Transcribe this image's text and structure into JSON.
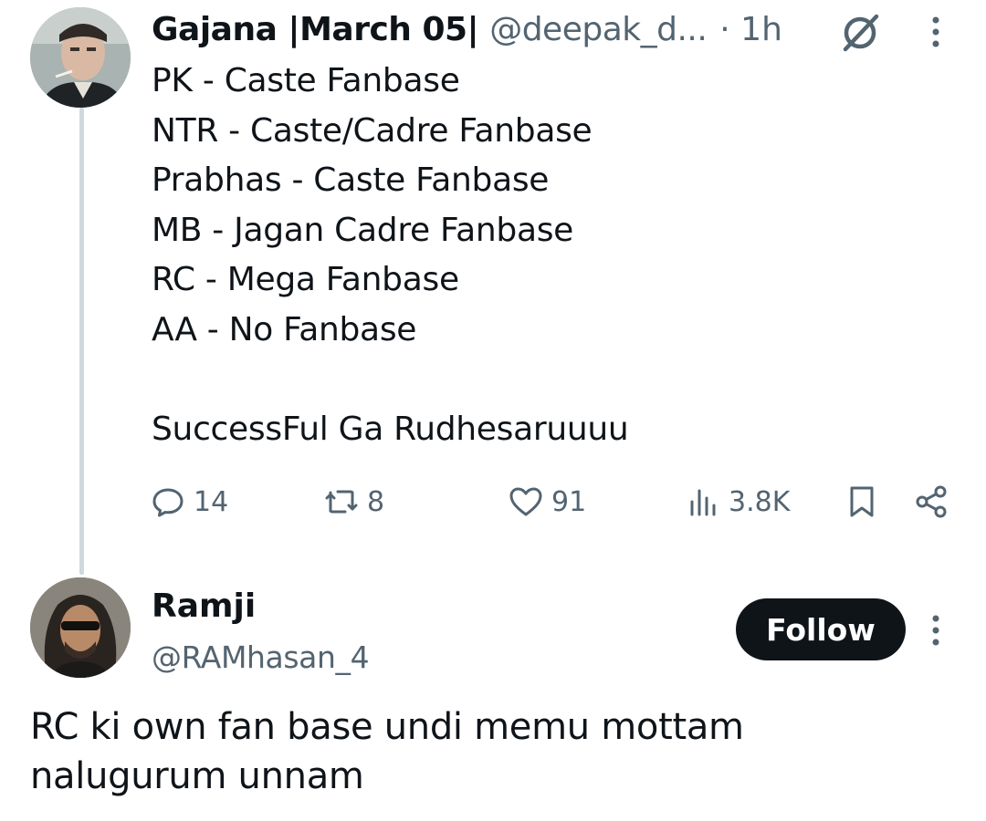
{
  "tweet1": {
    "display_name": "Gajana |March 05|",
    "handle": "@deepak_d...",
    "time": "· 1h",
    "lines": [
      "PK - Caste Fanbase",
      "NTR - Caste/Cadre Fanbase",
      "Prabhas - Caste Fanbase",
      "MB - Jagan Cadre Fanbase",
      "RC - Mega Fanbase",
      "AA - No Fanbase",
      "",
      "SuccessFul Ga Rudhesaruuuu"
    ],
    "actions": {
      "replies": "14",
      "retweets": "8",
      "likes": "91",
      "views": "3.8K"
    },
    "icons": {
      "grok": "grok-icon",
      "more": "more-vertical-icon",
      "reply": "reply-icon",
      "retweet": "retweet-icon",
      "like": "heart-icon",
      "views": "views-icon",
      "bookmark": "bookmark-icon",
      "share": "share-icon"
    }
  },
  "tweet2": {
    "display_name": "Ramji",
    "handle": "@RAMhasan_4",
    "follow_label": "Follow",
    "text_lines": [
      "RC ki own fan base undi memu mottam",
      "nalugurum unnam"
    ]
  },
  "colors": {
    "text_primary": "#0f1419",
    "text_secondary": "#536471",
    "thread_line": "#cfd9de",
    "follow_bg": "#0f1419"
  }
}
